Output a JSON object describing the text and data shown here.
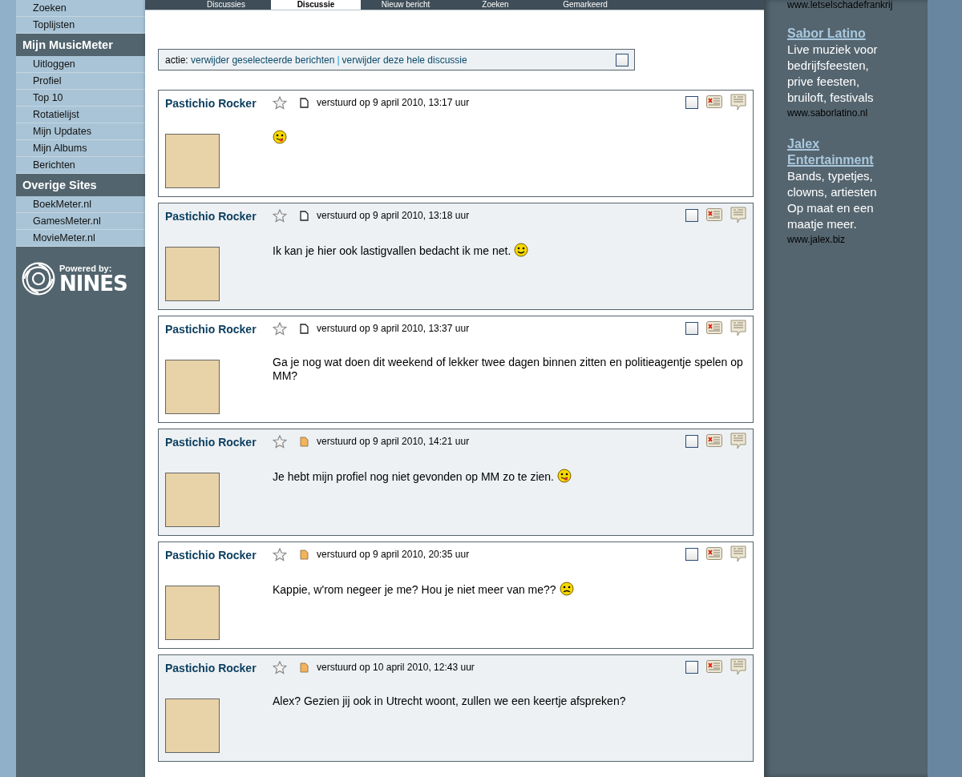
{
  "sidebar": {
    "sections": [
      {
        "items": [
          "Zoeken",
          "Toplijsten"
        ]
      },
      {
        "heading": "Mijn MusicMeter",
        "items": [
          "Uitloggen",
          "Profiel",
          "Top 10",
          "Rotatielijst",
          "Mijn Updates",
          "Mijn Albums",
          "Berichten"
        ]
      },
      {
        "heading": "Overige Sites",
        "items": [
          "BoekMeter.nl",
          "GamesMeter.nl",
          "MovieMeter.nl"
        ]
      }
    ],
    "logo": {
      "caption": "Powered by:",
      "name": "NINES"
    }
  },
  "tabs": [
    {
      "label": "Discussies",
      "selected": false
    },
    {
      "label": "Discussie",
      "selected": true
    },
    {
      "label": "Nieuw bericht",
      "selected": false
    },
    {
      "label": "Zoeken",
      "selected": false
    },
    {
      "label": "Gemarkeerd",
      "selected": false
    }
  ],
  "action_bar": {
    "label": "actie:",
    "links": [
      "verwijder geselecteerde berichten",
      "verwijder deze hele discussie"
    ],
    "separator": "|",
    "checked": false
  },
  "messages": [
    {
      "author": "Pastichio Rocker",
      "sent": "verstuurd op 9 april 2010, 13:17 uur",
      "read": true,
      "checked": false,
      "smiley": {
        "kind": "tongue"
      }
    },
    {
      "author": "Pastichio Rocker",
      "sent": "verstuurd op 9 april 2010, 13:18 uur",
      "read": true,
      "checked": false,
      "text": "Ik kan je hier ook lastigvallen bedacht ik me net.",
      "smiley": {
        "kind": "smile"
      }
    },
    {
      "author": "Pastichio Rocker",
      "sent": "verstuurd op 9 april 2010, 13:37 uur",
      "read": true,
      "checked": false,
      "text": "Ga je nog wat doen dit weekend of lekker twee dagen binnen zitten en politieagentje spelen op MM?"
    },
    {
      "author": "Pastichio Rocker",
      "sent": "verstuurd op 9 april 2010, 14:21 uur",
      "read": false,
      "checked": false,
      "text": "Je hebt mijn profiel nog niet gevonden op MM zo te zien.",
      "smiley": {
        "kind": "tongue"
      }
    },
    {
      "author": "Pastichio Rocker",
      "sent": "verstuurd op 9 april 2010, 20:35 uur",
      "read": false,
      "checked": false,
      "text": "Kappie, w'rom negeer je me? Hou je niet meer van me??",
      "smiley": {
        "kind": "sad"
      }
    },
    {
      "author": "Pastichio Rocker",
      "sent": "verstuurd op 10 april 2010, 12:43 uur",
      "read": false,
      "checked": false,
      "text": "Alex? Gezien jij ook in Utrecht woont, zullen we een keertje afspreken?"
    }
  ],
  "ads": [
    {
      "url": "www.letselschadefrankrij"
    },
    {
      "title": "Sabor Latino",
      "lines": [
        "Live muziek voor bedrijfsfeesten, prive feesten, bruiloft, festivals"
      ],
      "url": "www.saborlatino.nl"
    },
    {
      "title": "Jalex Entertainment",
      "lines": [
        "Bands, typetjes, clowns, artiesten Op maat en een maatje meer."
      ],
      "url": "www.jalex.biz"
    }
  ]
}
